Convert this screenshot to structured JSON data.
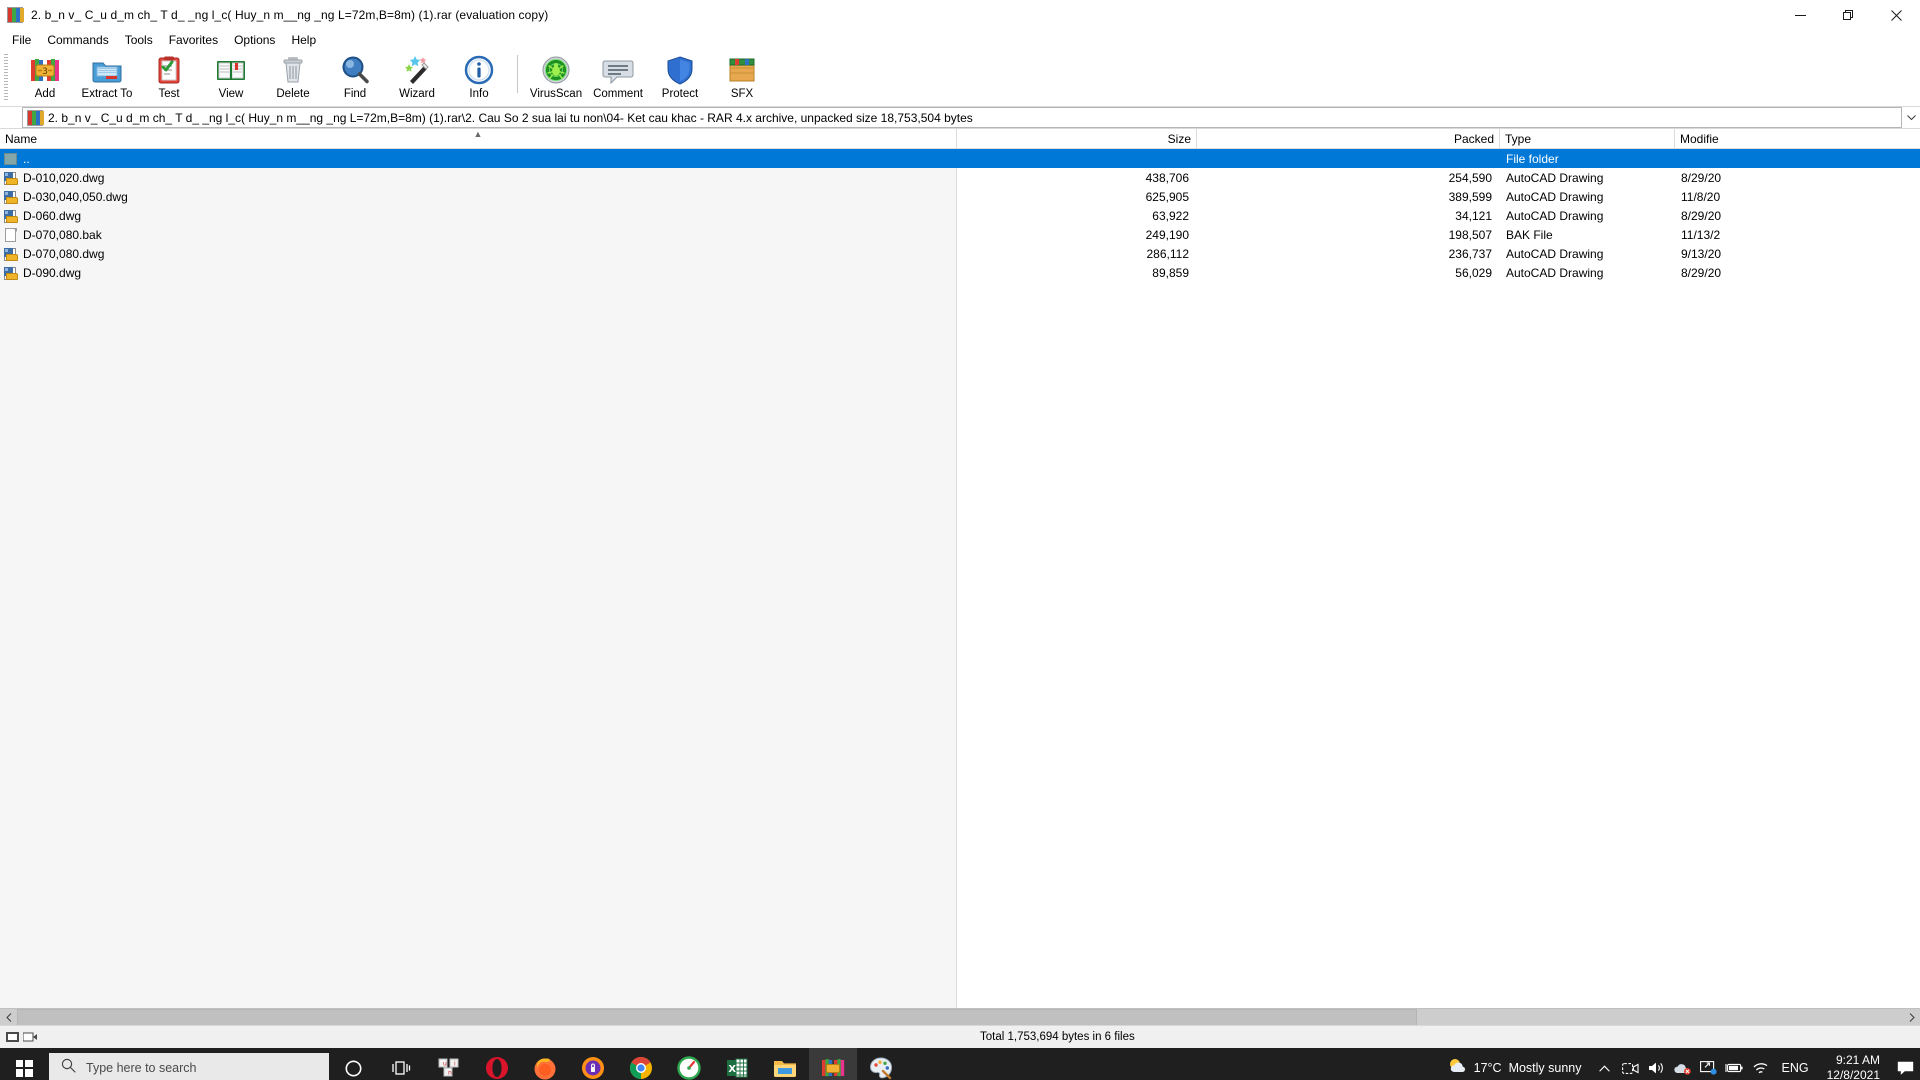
{
  "window": {
    "title": "2. b_n v_ C_u d_m ch_ T d_ _ng l_c( Huy_n m__ng _ng L=72m,B=8m) (1).rar (evaluation copy)",
    "app_icon": "winrar-books-icon",
    "controls": {
      "minimize": "minimize-icon",
      "maximize": "restore-icon",
      "close": "close-icon"
    }
  },
  "menubar": {
    "items": [
      {
        "label": "File"
      },
      {
        "label": "Commands"
      },
      {
        "label": "Tools"
      },
      {
        "label": "Favorites"
      },
      {
        "label": "Options"
      },
      {
        "label": "Help"
      }
    ]
  },
  "toolbar": {
    "buttons": [
      {
        "label": "Add",
        "icon": "add-archive-icon"
      },
      {
        "label": "Extract To",
        "icon": "extract-folder-icon"
      },
      {
        "label": "Test",
        "icon": "test-clipboard-icon"
      },
      {
        "label": "View",
        "icon": "view-book-icon"
      },
      {
        "label": "Delete",
        "icon": "delete-trash-icon"
      },
      {
        "label": "Find",
        "icon": "find-magnifier-icon"
      },
      {
        "label": "Wizard",
        "icon": "wizard-wand-icon"
      },
      {
        "label": "Info",
        "icon": "info-circle-icon"
      },
      {
        "label": "VirusScan",
        "icon": "virusscan-bug-icon"
      },
      {
        "label": "Comment",
        "icon": "comment-bubble-icon"
      },
      {
        "label": "Protect",
        "icon": "protect-shield-icon"
      },
      {
        "label": "SFX",
        "icon": "sfx-box-icon"
      }
    ]
  },
  "addressbar": {
    "icon": "winrar-books-icon",
    "path": "2. b_n v_ C_u d_m ch_ T d_ _ng l_c( Huy_n m__ng _ng L=72m,B=8m) (1).rar\\2. Cau So 2 sua lai tu non\\04- Ket cau khac - RAR 4.x archive, unpacked size 18,753,504 bytes",
    "dropdown": "chevron-down-icon"
  },
  "filelist": {
    "columns": [
      {
        "key": "name",
        "label": "Name",
        "sorted": true,
        "sort_dir": "asc"
      },
      {
        "key": "size",
        "label": "Size"
      },
      {
        "key": "packed",
        "label": "Packed"
      },
      {
        "key": "type",
        "label": "Type"
      },
      {
        "key": "modified",
        "label": "Modifie"
      }
    ],
    "rows": [
      {
        "name": "..",
        "icon": "parent-folder-icon",
        "size": "",
        "packed": "",
        "type": "File folder",
        "modified": "",
        "selected": true
      },
      {
        "name": "D-010,020.dwg",
        "icon": "autocad-dwg-icon",
        "size": "438,706",
        "packed": "254,590",
        "type": "AutoCAD Drawing",
        "modified": "8/29/20",
        "selected": false
      },
      {
        "name": "D-030,040,050.dwg",
        "icon": "autocad-dwg-icon",
        "size": "625,905",
        "packed": "389,599",
        "type": "AutoCAD Drawing",
        "modified": "11/8/20",
        "selected": false
      },
      {
        "name": "D-060.dwg",
        "icon": "autocad-dwg-icon",
        "size": "63,922",
        "packed": "34,121",
        "type": "AutoCAD Drawing",
        "modified": "8/29/20",
        "selected": false
      },
      {
        "name": "D-070,080.bak",
        "icon": "generic-file-icon",
        "size": "249,190",
        "packed": "198,507",
        "type": "BAK File",
        "modified": "11/13/2",
        "selected": false
      },
      {
        "name": "D-070,080.dwg",
        "icon": "autocad-dwg-icon",
        "size": "286,112",
        "packed": "236,737",
        "type": "AutoCAD Drawing",
        "modified": "9/13/20",
        "selected": false
      },
      {
        "name": "D-090.dwg",
        "icon": "autocad-dwg-icon",
        "size": "89,859",
        "packed": "56,029",
        "type": "AutoCAD Drawing",
        "modified": "8/29/20",
        "selected": false
      }
    ]
  },
  "scrollbar": {
    "left_arrow": "chevron-left-icon",
    "right_arrow": "chevron-right-icon"
  },
  "statusbar": {
    "lock_icon": "archive-status-icon",
    "disk_icon": "disk-status-icon",
    "total": "Total 1,753,694 bytes in 6 files"
  },
  "taskbar": {
    "start": "windows-logo-icon",
    "search_placeholder": "Type here to search",
    "search_icon": "search-icon",
    "cortana": "cortana-circle-icon",
    "task_view": "task-view-icon",
    "apps": [
      {
        "name": "unikey-app-icon",
        "running": false
      },
      {
        "name": "opera-browser-icon",
        "running": false
      },
      {
        "name": "firefox-browser-icon",
        "running": false
      },
      {
        "name": "avast-secure-browser-icon",
        "running": true
      },
      {
        "name": "google-chrome-icon",
        "running": false
      },
      {
        "name": "speed-test-icon",
        "running": false
      },
      {
        "name": "microsoft-excel-icon",
        "running": true
      },
      {
        "name": "file-explorer-icon",
        "running": true
      },
      {
        "name": "winrar-icon",
        "running": true,
        "active": true
      },
      {
        "name": "paint-icon",
        "running": true
      }
    ],
    "tray": {
      "weather_icon": "partly-sunny-icon",
      "temperature": "17°C",
      "condition": "Mostly sunny",
      "overflow": "chevron-up-icon",
      "icons": [
        "meet-now-icon",
        "volume-icon",
        "onedrive-paused-icon",
        "screen-share-icon",
        "battery-icon",
        "wifi-icon"
      ],
      "language": "ENG",
      "time": "9:21 AM",
      "date": "12/8/2021",
      "notifications": "action-center-icon"
    }
  },
  "colors": {
    "selection": "#0078d7",
    "taskbar": "#1f1f1f",
    "name_col_bg": "#f6f6f6"
  }
}
